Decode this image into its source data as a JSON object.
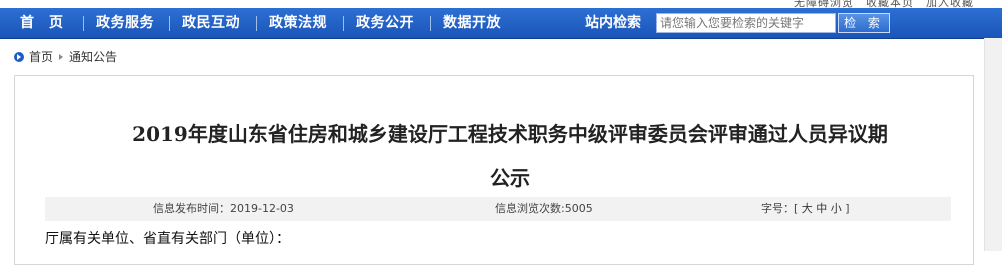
{
  "top_strip": {
    "text": "无障碍浏览　收藏本页　加入收藏"
  },
  "nav": {
    "items": [
      {
        "label": "首　页"
      },
      {
        "label": "政务服务"
      },
      {
        "label": "政民互动"
      },
      {
        "label": "政策法规"
      },
      {
        "label": "政务公开"
      },
      {
        "label": "数据开放"
      }
    ],
    "search_label": "站内检索",
    "search_placeholder": "请您输入您要检索的关键字",
    "search_button": "检 索"
  },
  "breadcrumb": {
    "home": "首页",
    "current": "通知公告"
  },
  "article": {
    "title_line1": "2019年度山东省住房和城乡建设厅工程技术职务中级评审委员会评审通过人员异议期",
    "title_line2": "公示",
    "publish_label": "信息发布时间：",
    "publish_date": "2019-12-03",
    "views_label": "信息浏览次数:",
    "views_count": "5005",
    "font_size_label": "字号：",
    "bracket_open": "[",
    "size_large": "大",
    "size_medium": "中",
    "size_small": "小",
    "bracket_close": "]",
    "first_line": "厅属有关单位、省直有关部门（单位）："
  },
  "colors": {
    "nav_blue": "#1b55b8",
    "breadcrumb_icon": "#1b5cc6",
    "meta_background": "#f2f2f2"
  }
}
